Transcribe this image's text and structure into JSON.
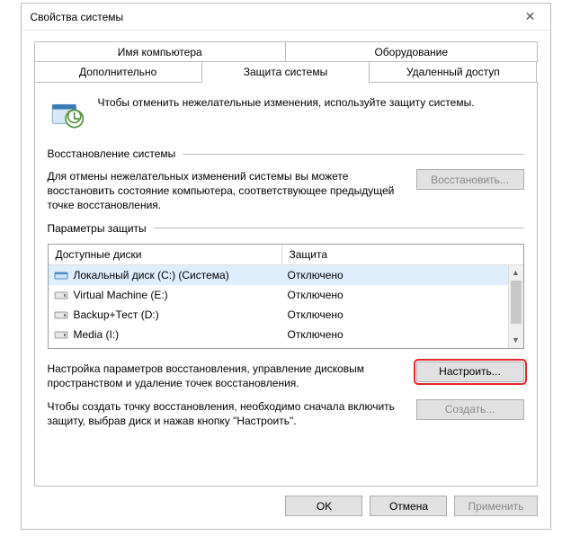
{
  "window": {
    "title": "Свойства системы"
  },
  "tabs": {
    "row1": [
      "Имя компьютера",
      "Оборудование"
    ],
    "row2": [
      "Дополнительно",
      "Защита системы",
      "Удаленный доступ"
    ],
    "active": "Защита системы"
  },
  "intro": "Чтобы отменить нежелательные изменения, используйте защиту системы.",
  "sections": {
    "restore": {
      "title": "Восстановление системы",
      "text": "Для отмены нежелательных изменений системы вы можете восстановить состояние компьютера, соответствующее предыдущей точке восстановления.",
      "button": "Восстановить..."
    },
    "protection": {
      "title": "Параметры защиты",
      "columns": {
        "drive": "Доступные диски",
        "status": "Защита"
      },
      "rows": [
        {
          "name": "Локальный диск (C:) (Система)",
          "status": "Отключено",
          "type": "local",
          "selected": true
        },
        {
          "name": "Virtual Machine (E:)",
          "status": "Отключено",
          "type": "ext",
          "selected": false
        },
        {
          "name": "Backup+Тест (D:)",
          "status": "Отключено",
          "type": "ext",
          "selected": false
        },
        {
          "name": "Media (I:)",
          "status": "Отключено",
          "type": "ext",
          "selected": false
        }
      ],
      "configure": {
        "text": "Настройка параметров восстановления, управление дисковым пространством и удаление точек восстановления.",
        "button": "Настроить..."
      },
      "create": {
        "text": "Чтобы создать точку восстановления, необходимо сначала включить защиту, выбрав диск и нажав кнопку \"Настроить\".",
        "button": "Создать..."
      }
    }
  },
  "footer": {
    "ok": "OK",
    "cancel": "Отмена",
    "apply": "Применить"
  }
}
